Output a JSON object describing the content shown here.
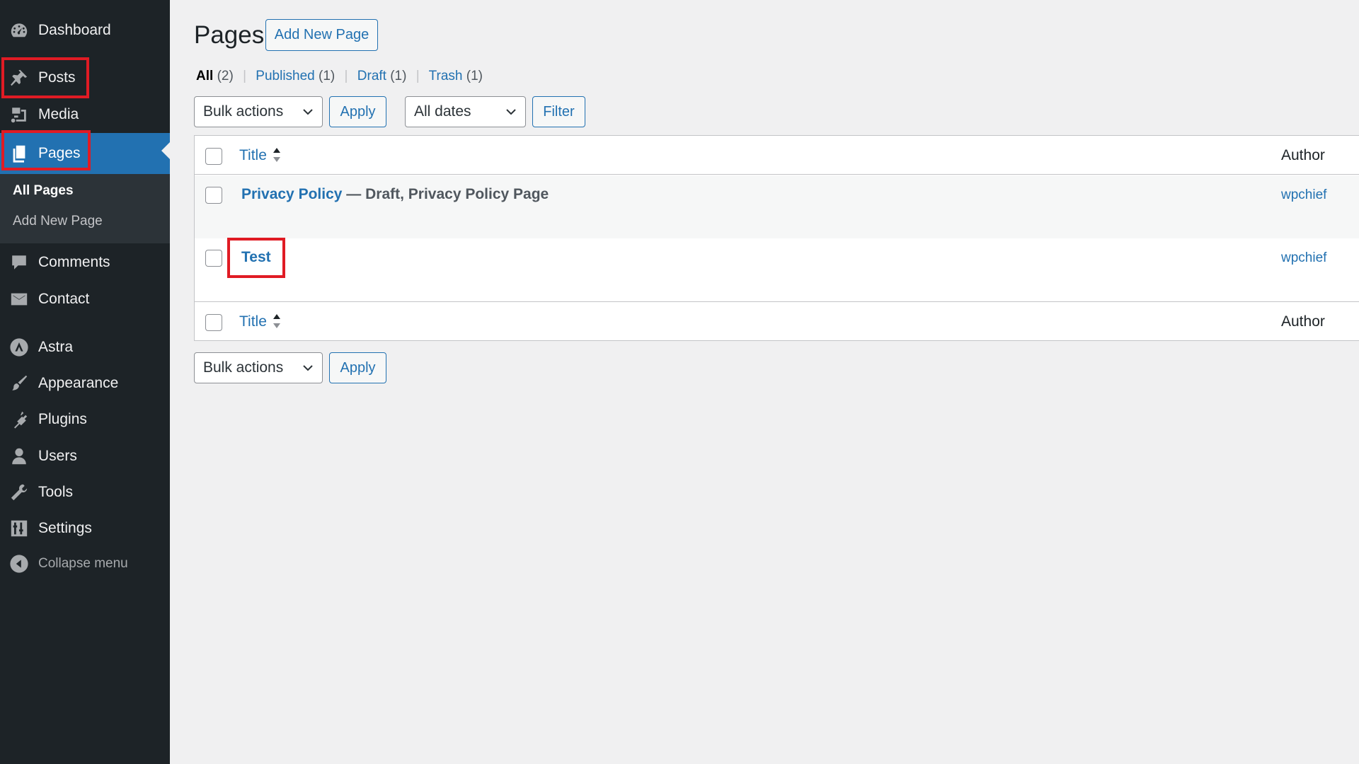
{
  "sidebar": {
    "items": [
      {
        "label": "Dashboard",
        "icon": "dashboard-icon"
      },
      {
        "label": "Posts",
        "icon": "pin-icon"
      },
      {
        "label": "Media",
        "icon": "media-icon"
      },
      {
        "label": "Pages",
        "icon": "pages-icon"
      },
      {
        "label": "Comments",
        "icon": "comment-icon"
      },
      {
        "label": "Contact",
        "icon": "envelope-icon"
      },
      {
        "label": "Astra",
        "icon": "astra-icon"
      },
      {
        "label": "Appearance",
        "icon": "brush-icon"
      },
      {
        "label": "Plugins",
        "icon": "plug-icon"
      },
      {
        "label": "Users",
        "icon": "user-icon"
      },
      {
        "label": "Tools",
        "icon": "wrench-icon"
      },
      {
        "label": "Settings",
        "icon": "sliders-icon"
      }
    ],
    "submenu": [
      "All Pages",
      "Add New Page"
    ],
    "collapse_label": "Collapse menu"
  },
  "header": {
    "title": "Pages",
    "add_new_label": "Add New Page"
  },
  "views": [
    {
      "label": "All",
      "count": "(2)"
    },
    {
      "label": "Published",
      "count": "(1)"
    },
    {
      "label": "Draft",
      "count": "(1)"
    },
    {
      "label": "Trash",
      "count": "(1)"
    }
  ],
  "filters": {
    "bulk_actions": "Bulk actions",
    "apply_label": "Apply",
    "dates": "All dates",
    "filter_label": "Filter"
  },
  "table": {
    "columns": {
      "title": "Title",
      "author": "Author"
    },
    "rows": [
      {
        "title": "Privacy Policy",
        "state": " — Draft, Privacy Policy Page",
        "author": "wpchief"
      },
      {
        "title": "Test",
        "state": "",
        "author": "wpchief"
      }
    ]
  },
  "colors": {
    "accent": "#2271b1",
    "sidebar": "#1d2327",
    "highlight": "#e01b24"
  }
}
